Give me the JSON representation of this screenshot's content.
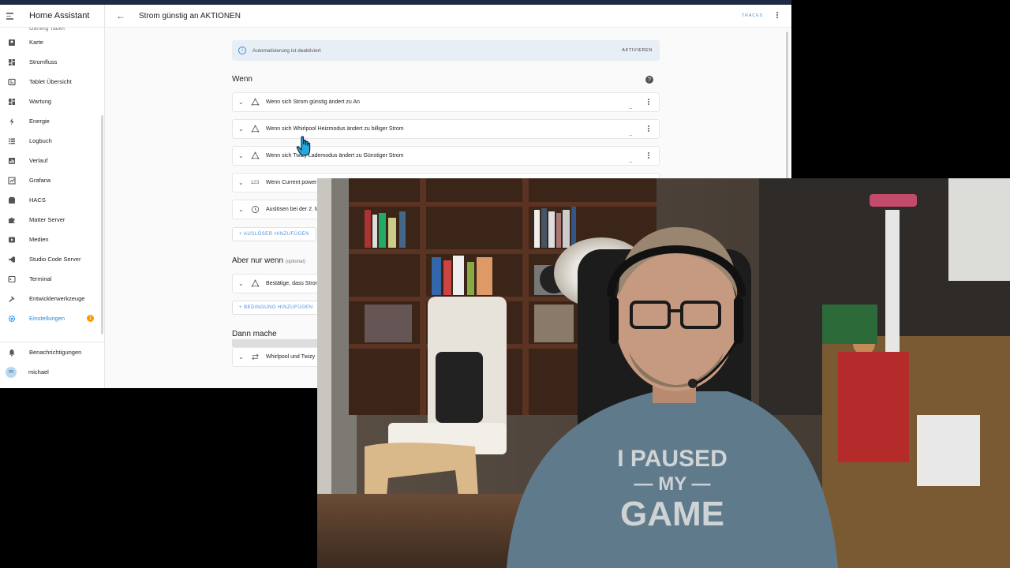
{
  "sidebar": {
    "title": "Home Assistant",
    "cut_item": "Gaming Tablet",
    "items": [
      {
        "label": "Karte",
        "icon": "map-icon"
      },
      {
        "label": "Stromfluss",
        "icon": "dashboard-icon"
      },
      {
        "label": "Tablet Übersicht",
        "icon": "tablet-icon"
      },
      {
        "label": "Wartung",
        "icon": "dashboard-icon"
      },
      {
        "label": "Energie",
        "icon": "lightning-icon"
      },
      {
        "label": "Logbuch",
        "icon": "list-icon"
      },
      {
        "label": "Verlauf",
        "icon": "chart-icon"
      },
      {
        "label": "Grafana",
        "icon": "chart-box-icon"
      },
      {
        "label": "HACS",
        "icon": "hacs-icon"
      },
      {
        "label": "Matter Server",
        "icon": "puzzle-icon"
      },
      {
        "label": "Medien",
        "icon": "media-icon"
      },
      {
        "label": "Studio Code Server",
        "icon": "vscode-icon"
      },
      {
        "label": "Terminal",
        "icon": "terminal-icon"
      },
      {
        "label": "Entwicklerwerkzeuge",
        "icon": "hammer-icon"
      },
      {
        "label": "Einstellungen",
        "icon": "gear-icon",
        "badge": "1"
      }
    ],
    "bottom": [
      {
        "label": "Benachrichtigungen",
        "icon": "bell-icon"
      },
      {
        "label": "michael",
        "avatar": "m"
      }
    ]
  },
  "header": {
    "title": "Strom günstig an AKTIONEN",
    "traces": "TRACES"
  },
  "alert": {
    "text": "Automatisierung ist deaktiviert",
    "action": "AKTIVIEREN"
  },
  "sections": {
    "wenn": "Wenn",
    "aber": "Aber nur wenn",
    "aber_optional": "(optional)",
    "dann": "Dann mache"
  },
  "triggers": [
    {
      "text": "Wenn sich Strom günstig ändert zu An",
      "icon": "state-icon"
    },
    {
      "text": "Wenn sich Whirlpool Heizmodus ändert zu billiger Strom",
      "icon": "state-icon"
    },
    {
      "text": "Wenn sich Twizy Lademodus ändert zu Günstiger Strom",
      "icon": "state-icon"
    },
    {
      "text": "Wenn Current power",
      "icon": "numeric-icon",
      "icon_text": "123"
    },
    {
      "text": "Auslösen bei der 2. M",
      "icon": "clock-icon"
    }
  ],
  "add_trigger": "AUSLÖSER HINZUFÜGEN",
  "conditions": [
    {
      "text": "Bestätige, dass Stron",
      "icon": "state-icon"
    }
  ],
  "add_condition": "BEDINGUNG HINZUFÜGEN",
  "actions": [
    {
      "text": "Whirlpool und Twizy",
      "icon": "swap-icon"
    }
  ],
  "webcam": {
    "shirt_text_1": "I PAUSED",
    "shirt_text_2": "— MY —",
    "shirt_text_3": "GAME"
  },
  "colors": {
    "accent": "#1e88e5",
    "badge": "#ff9800",
    "alert_bg": "#e7eef6",
    "link": "#4a90d9"
  }
}
